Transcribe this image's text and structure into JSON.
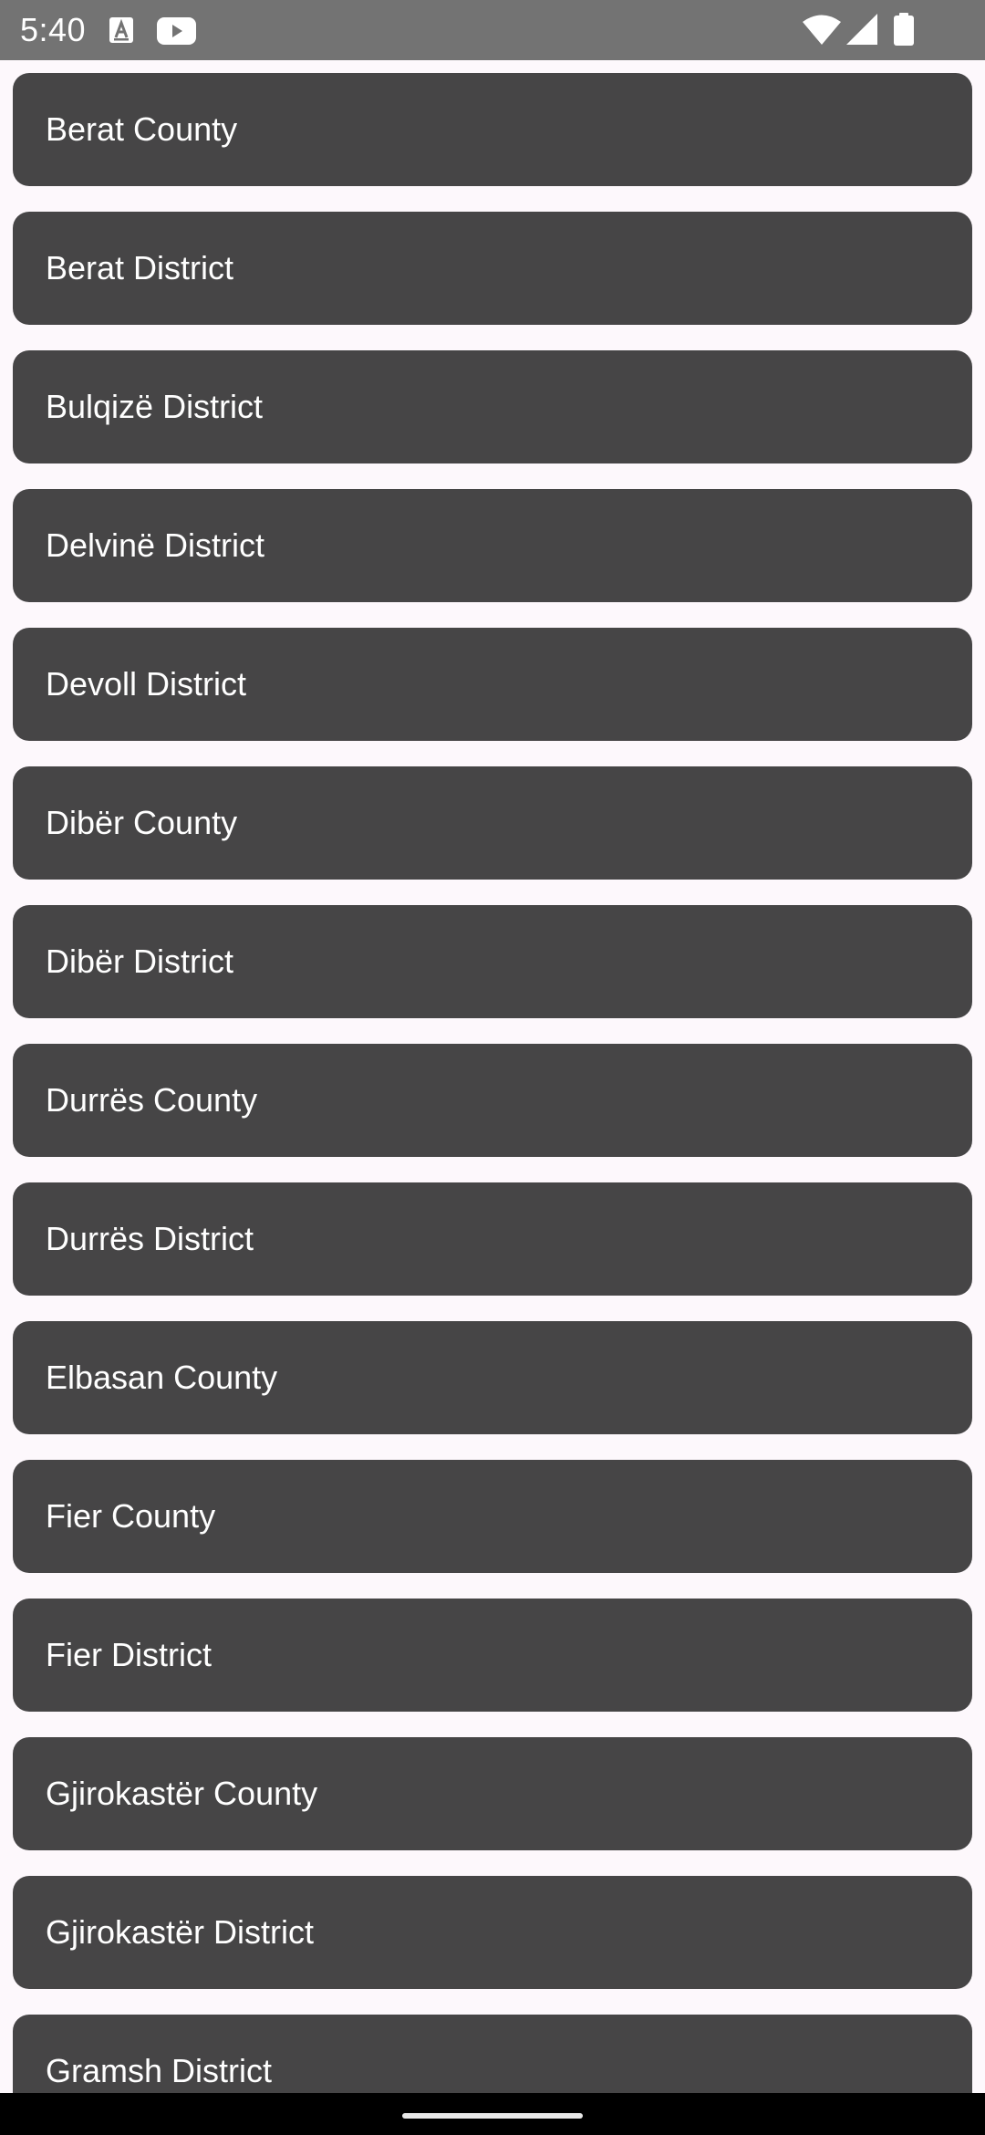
{
  "status_bar": {
    "time": "5:40",
    "icons": [
      "font-notification-icon",
      "youtube-notification-icon",
      "wifi-icon",
      "cell-signal-icon",
      "battery-icon"
    ]
  },
  "list": {
    "items": [
      {
        "label": "Berat County"
      },
      {
        "label": "Berat District"
      },
      {
        "label": "Bulqizë District"
      },
      {
        "label": "Delvinë District"
      },
      {
        "label": "Devoll District"
      },
      {
        "label": "Dibër County"
      },
      {
        "label": "Dibër District"
      },
      {
        "label": "Durrës County"
      },
      {
        "label": "Durrës District"
      },
      {
        "label": "Elbasan County"
      },
      {
        "label": "Fier County"
      },
      {
        "label": "Fier District"
      },
      {
        "label": "Gjirokastër County"
      },
      {
        "label": "Gjirokastër District"
      },
      {
        "label": "Gramsh District"
      }
    ]
  },
  "colors": {
    "background": "#fdf8fc",
    "item_background": "#464546",
    "item_text": "#ffffff",
    "status_bar": "#737373",
    "nav_bar": "#000000"
  }
}
